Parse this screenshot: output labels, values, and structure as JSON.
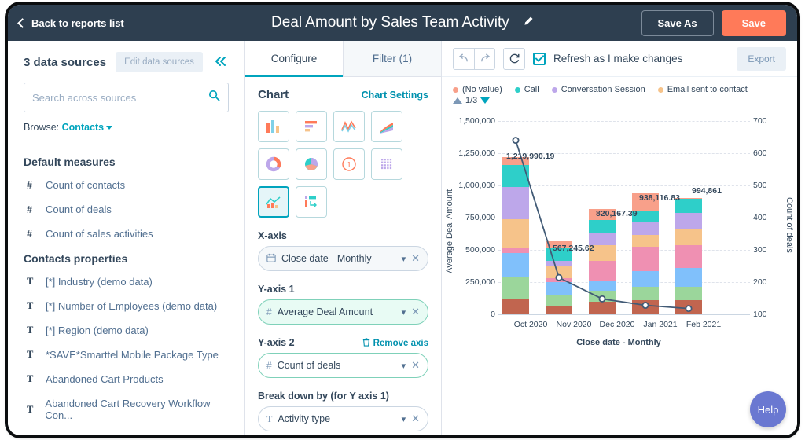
{
  "topbar": {
    "back_label": "Back to reports list",
    "title": "Deal Amount by Sales Team Activity",
    "edit_icon": "pencil-icon",
    "save_as_label": "Save As",
    "save_label": "Save",
    "bg_color": "#2e3f50",
    "save_color": "#ff7a59"
  },
  "sidebar": {
    "data_sources_label": "3 data sources",
    "edit_data_sources_label": "Edit data sources",
    "collapse_icon": "double-chevron-left-icon",
    "search": {
      "placeholder": "Search across sources",
      "value": "",
      "icon": "search-icon"
    },
    "browse_label": "Browse:",
    "browse_value": "Contacts",
    "groups": [
      {
        "title": "Default measures",
        "items": [
          {
            "type": "#",
            "label": "Count of contacts"
          },
          {
            "type": "#",
            "label": "Count of deals"
          },
          {
            "type": "#",
            "label": "Count of sales activities"
          }
        ]
      },
      {
        "title": "Contacts properties",
        "items": [
          {
            "type": "T",
            "label": "[*] Industry (demo data)"
          },
          {
            "type": "T",
            "label": "[*] Number of Employees (demo data)"
          },
          {
            "type": "T",
            "label": "[*] Region (demo data)"
          },
          {
            "type": "T",
            "label": "*SAVE*Smarttel Mobile Package Type"
          },
          {
            "type": "T",
            "label": "Abandoned Cart Products"
          },
          {
            "type": "T",
            "label": "Abandoned Cart Recovery Workflow Con..."
          }
        ]
      }
    ]
  },
  "configure": {
    "tabs": [
      {
        "label": "Configure",
        "active": true
      },
      {
        "label": "Filter (1)",
        "active": false
      }
    ],
    "chart_section_title": "Chart",
    "chart_settings_link": "Chart Settings",
    "chart_types": [
      {
        "name": "vertical-bar-chart-icon",
        "selected": false
      },
      {
        "name": "horizontal-bar-chart-icon",
        "selected": false
      },
      {
        "name": "line-chart-icon",
        "selected": false
      },
      {
        "name": "area-chart-icon",
        "selected": false
      },
      {
        "name": "donut-chart-icon",
        "selected": false
      },
      {
        "name": "pie-chart-icon",
        "selected": false
      },
      {
        "name": "single-value-icon",
        "selected": false
      },
      {
        "name": "table-chart-icon",
        "selected": false
      },
      {
        "name": "combo-chart-icon",
        "selected": true
      },
      {
        "name": "pivot-table-icon",
        "selected": false
      }
    ],
    "x_axis_label": "X-axis",
    "x_axis_value": "Close date - Monthly",
    "x_axis_type_icon": "calendar-icon",
    "y_axis_1_label": "Y-axis 1",
    "y_axis_1_value": "Average Deal Amount",
    "y_axis_1_type_icon": "number-icon",
    "y_axis_2_label": "Y-axis 2",
    "y_axis_2_value": "Count of deals",
    "y_axis_2_type_icon": "number-icon",
    "remove_axis_label": "Remove axis",
    "remove_axis_icon": "trash-icon",
    "breakdown_label": "Break down by (for Y axis 1)",
    "breakdown_value": "Activity type",
    "breakdown_type_icon": "text-icon"
  },
  "controls": {
    "undo_icon": "undo-icon",
    "redo_icon": "redo-icon",
    "refresh_icon": "refresh-icon",
    "checkbox_checked": true,
    "refresh_label": "Refresh as I make changes",
    "export_label": "Export"
  },
  "help": {
    "label": "Help",
    "color": "#6a78d1"
  },
  "chart_data": {
    "type": "bar",
    "title": "",
    "xlabel": "Close date - Monthly",
    "ylabel": "Average Deal Amount",
    "y2label": "Count of deals",
    "categories": [
      "Oct 2020",
      "Nov 2020",
      "Dec 2020",
      "Jan 2021",
      "Feb 2021"
    ],
    "ylim": [
      0,
      1500000
    ],
    "yticks": [
      0,
      250000,
      500000,
      750000,
      1000000,
      1250000,
      1500000
    ],
    "ytick_labels": [
      "0",
      "250,000",
      "500,000",
      "750,000",
      "1,000,000",
      "1,250,000",
      "1,500,000"
    ],
    "y2lim": [
      100,
      700
    ],
    "y2ticks": [
      100,
      200,
      300,
      400,
      500,
      600,
      700
    ],
    "y2tick_labels": [
      "100",
      "200",
      "300",
      "400",
      "500",
      "600",
      "700"
    ],
    "grid": true,
    "legend_position": "top",
    "legend_page": "1/3",
    "legend": [
      {
        "label": "(No value)",
        "color": "#f8a08a"
      },
      {
        "label": "Call",
        "color": "#2ecfc9"
      },
      {
        "label": "Conversation Session",
        "color": "#bda7ea"
      },
      {
        "label": "Email sent to contact",
        "color": "#f6c38a"
      }
    ],
    "totals": [
      1219990.19,
      567245.62,
      820167.39,
      938116.83,
      994861
    ],
    "total_labels": [
      "1,219,990.19",
      "567,245.62",
      "820,167.39",
      "938,116.83",
      "994,861"
    ],
    "stack_series": [
      {
        "name": "seg-brown",
        "color": "#c1654f",
        "values": [
          125000,
          62000,
          95000,
          108000,
          112000
        ]
      },
      {
        "name": "seg-green",
        "color": "#9bd69b",
        "values": [
          170000,
          90000,
          85000,
          105000,
          100000
        ]
      },
      {
        "name": "seg-blue",
        "color": "#80c0fb",
        "values": [
          180000,
          100000,
          85000,
          120000,
          150000
        ]
      },
      {
        "name": "seg-pink",
        "color": "#ef90b2",
        "values": [
          35000,
          30000,
          150000,
          190000,
          175000
        ]
      },
      {
        "name": "seg-orange",
        "color": "#f6c38a",
        "values": [
          230000,
          95000,
          120000,
          95000,
          120000
        ]
      },
      {
        "name": "seg-purple",
        "color": "#bda7ea",
        "values": [
          250000,
          35000,
          95000,
          95000,
          130000
        ]
      },
      {
        "name": "seg-teal",
        "color": "#2ecfc9",
        "values": [
          170000,
          100000,
          100000,
          95000,
          108000
        ]
      },
      {
        "name": "seg-salmon",
        "color": "#f8a08a",
        "values": [
          60000,
          55000,
          90000,
          130000,
          8000
        ]
      }
    ],
    "line_series": {
      "name": "Count of deals",
      "color": "#425b76",
      "values": [
        640,
        214,
        148,
        128,
        118
      ]
    }
  }
}
